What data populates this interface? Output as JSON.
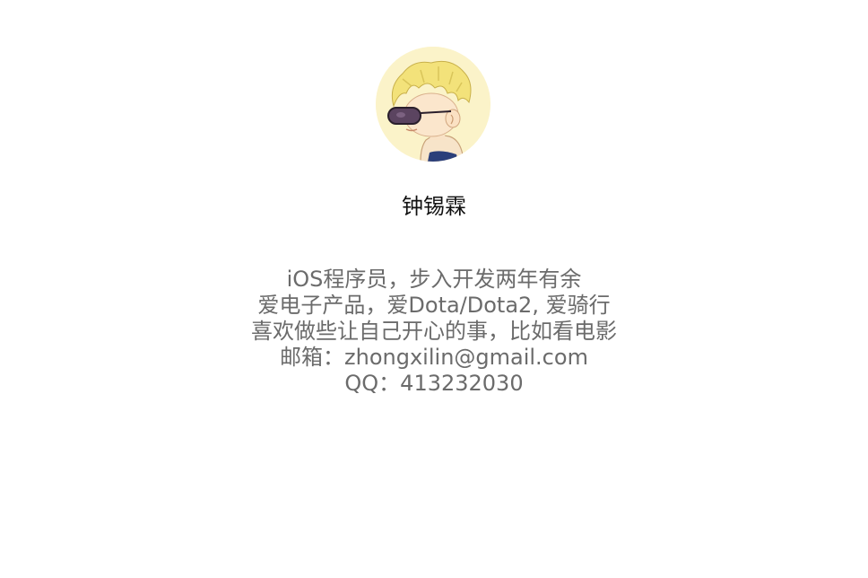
{
  "profile": {
    "name": "钟锡霖",
    "bio_lines": [
      "iOS程序员，步入开发两年有余",
      "爱电子产品，爱Dota/Dota2, 爱骑行",
      "喜欢做些让自己开心的事，比如看电影",
      "邮箱：zhongxilin@gmail.com",
      "QQ：413232030"
    ]
  },
  "colors": {
    "background": "#ffffff",
    "name_text": "#111111",
    "bio_text": "#6b6b6b",
    "avatar_background": "#fbf3c9"
  }
}
